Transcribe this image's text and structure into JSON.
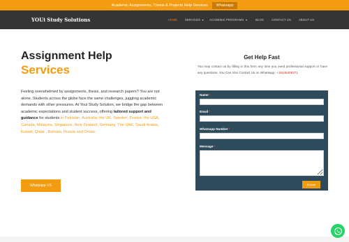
{
  "topbar": {
    "text": "Academic Assignments, Thesis & Projects Help Services",
    "button": "Whatsapp"
  },
  "navbar": {
    "brand": "YOUi Study Solutions",
    "items": [
      {
        "label": "HOME",
        "dropdown": false,
        "active": true
      },
      {
        "label": "SERVICES",
        "dropdown": true,
        "active": false
      },
      {
        "label": "ACADEMIC PROGRAMS",
        "dropdown": true,
        "active": false
      },
      {
        "label": "BLOG",
        "dropdown": false,
        "active": false
      },
      {
        "label": "CONTACT US",
        "dropdown": false,
        "active": false
      },
      {
        "label": "ABOUT US",
        "dropdown": false,
        "active": false
      }
    ]
  },
  "hero": {
    "title_line1": "Assignment Help",
    "title_line2": "Services",
    "para_part1": "Feeling overwhelmed by assignments, thesis, and research papers? You are not alone. Students across the globe face the same challenges, juggling academic demands with other pressures. At Youi Study Solution, we bridge the gap between academic expectations and student success, offering ",
    "para_bold": "tailored support and guidance",
    "para_part2": " for students ",
    "para_countries": "in Pakistan, Australia, the UK, Sweden, France, the USA, Canada, Malaysia, Singapore, New Zealand, Germany, The UAE, Saudi Arabia, Kuwait, Qatar , Bahrain, Russia and Oman.",
    "whatsapp_button": "Whatsapp US"
  },
  "help": {
    "title": "Get Help Fast",
    "desc": "You may contact us by filling in this form any time you need professional support or have any questions. You Can Also Contact Us on Whatsapp:",
    "phone": "+19145406371",
    "form": {
      "name_label": "Name",
      "email_label": "Email",
      "whatsapp_label": "Whatsapp Number",
      "message_label": "Message",
      "required_mark": "*",
      "submit_label": "Submit"
    }
  },
  "colors": {
    "accent": "#f39c12",
    "navbar": "#353535",
    "form_bg": "#2d4b5a",
    "whatsapp_green": "#25d366"
  },
  "icons": {
    "floating": "whatsapp-icon"
  }
}
